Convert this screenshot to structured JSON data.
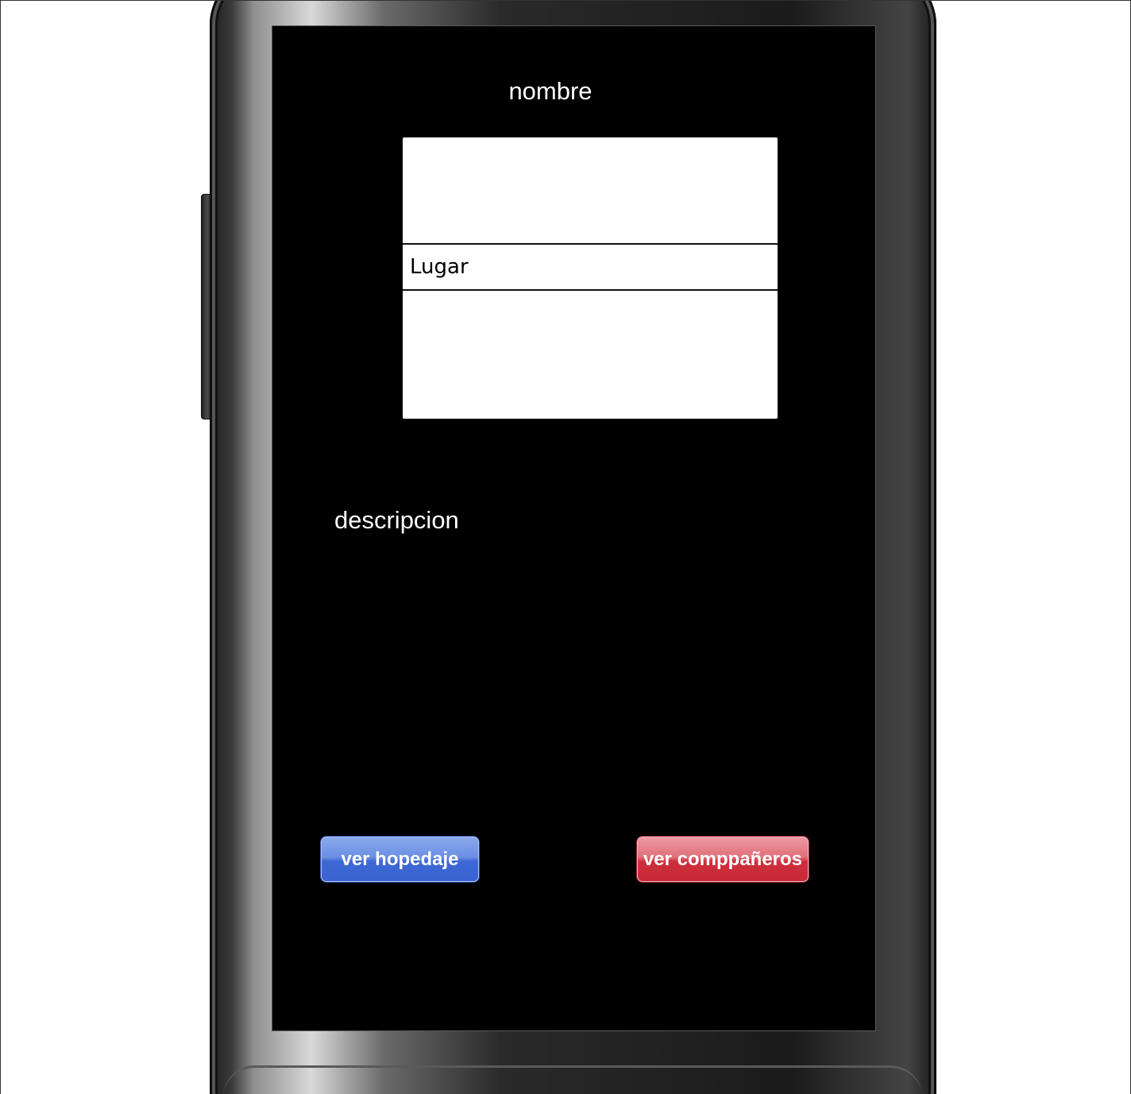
{
  "screen": {
    "title": "nombre",
    "image_placeholder": {
      "row_label": "Lugar"
    },
    "description_label": "descripcion"
  },
  "buttons": {
    "lodging_label": "ver hopedaje",
    "companions_label": "ver comppañeros"
  },
  "colors": {
    "screen_background": "#000000",
    "lodging_button": "#4a72da",
    "companions_button": "#d33a46"
  }
}
